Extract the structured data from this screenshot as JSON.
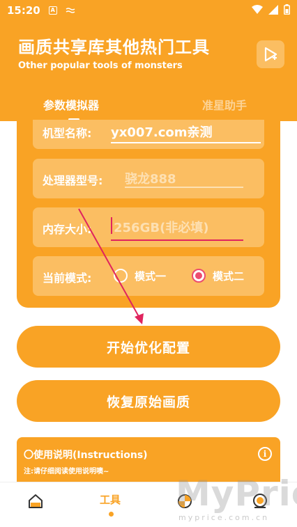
{
  "status_bar": {
    "time": "15:20",
    "icon_a": "A",
    "icons": [
      "wifi-icon",
      "signal-icon",
      "battery-icon"
    ]
  },
  "header": {
    "title": "画质共享库其他热门工具",
    "subtitle": "Other popular tools of monsters",
    "play_icon": "play-icon"
  },
  "tabs": [
    {
      "label": "参数模拟器",
      "active": true
    },
    {
      "label": "准星助手",
      "active": false
    }
  ],
  "form": {
    "model": {
      "label": "机型名称:",
      "value": "yx007.com亲测"
    },
    "cpu": {
      "label": "处理器型号:",
      "placeholder": "骁龙888"
    },
    "memory": {
      "label": "内存大小:",
      "placeholder": "256GB(非必填)"
    },
    "mode": {
      "label": "当前模式:",
      "options": [
        {
          "label": "模式一",
          "checked": false
        },
        {
          "label": "模式二",
          "checked": true
        }
      ]
    }
  },
  "buttons": {
    "optimize": "开始优化配置",
    "restore": "恢复原始画质"
  },
  "instructions": {
    "title": "〇使用说明(Instructions)",
    "note": "注:请仔细阅读使用说明噢~",
    "info_icon": "info-icon"
  },
  "bottom_nav": {
    "active_label": "工具",
    "items": [
      "home-icon",
      "tools",
      "chart-icon",
      "profile-icon"
    ]
  },
  "watermark": {
    "text": "MyPrice",
    "sub": "myprice.com.cn"
  },
  "colors": {
    "primary": "#f9a325",
    "field": "#fbbe62",
    "accent": "#ec4d6f",
    "arrow": "#e0245e"
  }
}
